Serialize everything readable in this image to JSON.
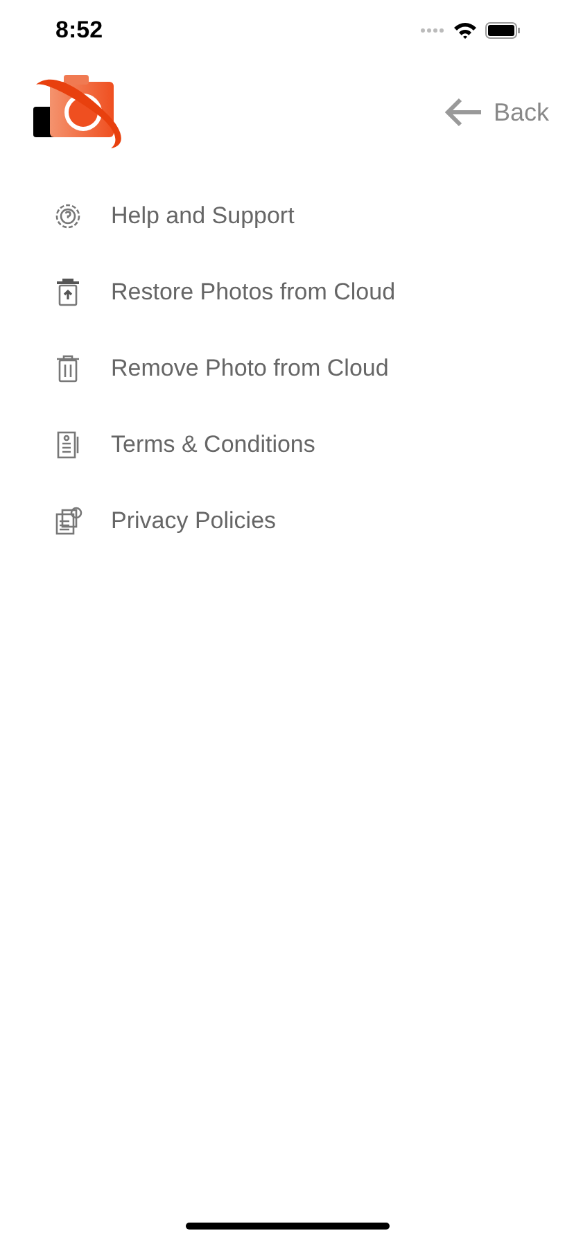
{
  "status_bar": {
    "time": "8:52"
  },
  "header": {
    "back_label": "Back"
  },
  "menu": [
    {
      "kind": "help",
      "label": "Help and Support"
    },
    {
      "kind": "restore",
      "label": "Restore Photos from Cloud"
    },
    {
      "kind": "remove",
      "label": "Remove Photo from Cloud"
    },
    {
      "kind": "terms",
      "label": "Terms & Conditions"
    },
    {
      "kind": "privacy",
      "label": "Privacy Policies"
    }
  ]
}
